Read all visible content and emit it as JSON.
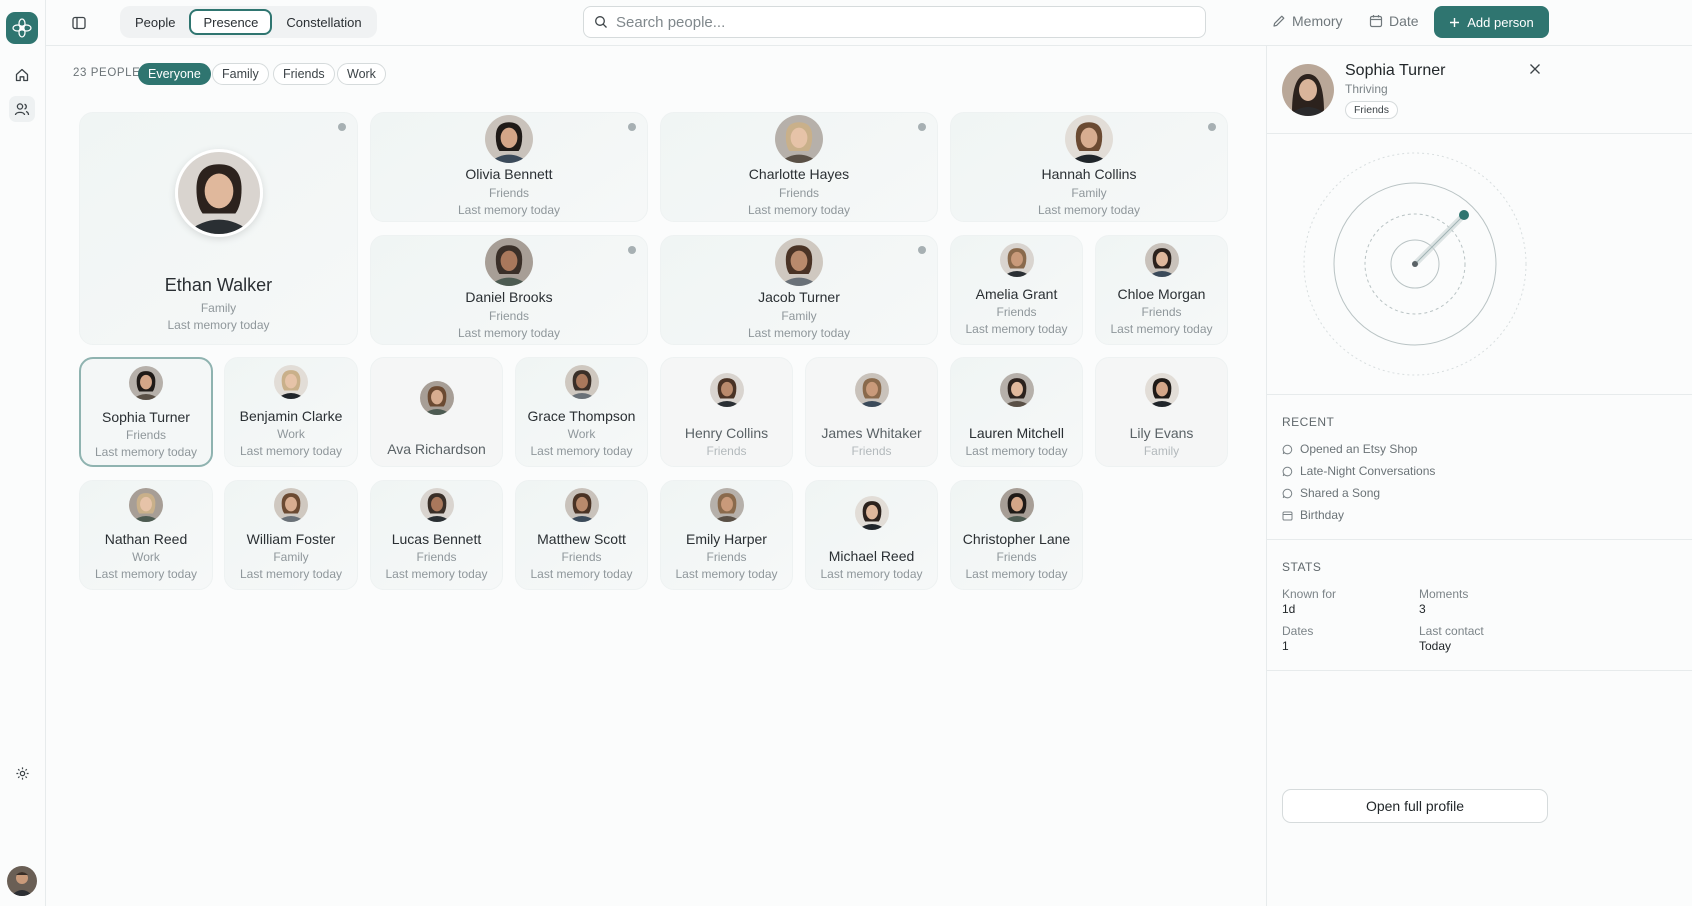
{
  "topbar": {
    "tabs": [
      "People",
      "Presence",
      "Constellation"
    ],
    "active_tab": "Presence",
    "search_placeholder": "Search people...",
    "memory_label": "Memory",
    "date_label": "Date",
    "add_person_label": "Add person"
  },
  "filters": {
    "count_label": "23 PEOPLE",
    "chips": [
      "Everyone",
      "Family",
      "Friends",
      "Work"
    ],
    "active_chip": "Everyone"
  },
  "people": [
    {
      "name": "Ethan Walker",
      "group": "Family",
      "last": "Last memory today"
    },
    {
      "name": "Olivia Bennett",
      "group": "Friends",
      "last": "Last memory today"
    },
    {
      "name": "Charlotte Hayes",
      "group": "Friends",
      "last": "Last memory today"
    },
    {
      "name": "Hannah Collins",
      "group": "Family",
      "last": "Last memory today"
    },
    {
      "name": "Daniel Brooks",
      "group": "Friends",
      "last": "Last memory today"
    },
    {
      "name": "Jacob Turner",
      "group": "Family",
      "last": "Last memory today"
    },
    {
      "name": "Amelia Grant",
      "group": "Friends",
      "last": "Last memory today"
    },
    {
      "name": "Chloe Morgan",
      "group": "Friends",
      "last": "Last memory today"
    },
    {
      "name": "Sophia Turner",
      "group": "Friends",
      "last": "Last memory today"
    },
    {
      "name": "Benjamin Clarke",
      "group": "Work",
      "last": "Last memory today"
    },
    {
      "name": "Ava Richardson",
      "group": "",
      "last": ""
    },
    {
      "name": "Grace Thompson",
      "group": "Work",
      "last": "Last memory today"
    },
    {
      "name": "Henry Collins",
      "group": "Friends",
      "last": ""
    },
    {
      "name": "James Whitaker",
      "group": "Friends",
      "last": ""
    },
    {
      "name": "Lauren Mitchell",
      "group": "",
      "last": "Last memory today"
    },
    {
      "name": "Lily Evans",
      "group": "Family",
      "last": ""
    },
    {
      "name": "Nathan Reed",
      "group": "Work",
      "last": "Last memory today"
    },
    {
      "name": "William Foster",
      "group": "Family",
      "last": "Last memory today"
    },
    {
      "name": "Lucas Bennett",
      "group": "Friends",
      "last": "Last memory today"
    },
    {
      "name": "Matthew Scott",
      "group": "Friends",
      "last": "Last memory today"
    },
    {
      "name": "Emily Harper",
      "group": "Friends",
      "last": "Last memory today"
    },
    {
      "name": "Michael Reed",
      "group": "",
      "last": "Last memory today"
    },
    {
      "name": "Christopher Lane",
      "group": "Friends",
      "last": "Last memory today"
    }
  ],
  "panel": {
    "name": "Sophia Turner",
    "status": "Thriving",
    "group": "Friends",
    "recent_title": "RECENT",
    "recent": [
      {
        "icon": "speech-bubble-icon",
        "label": "Opened an Etsy Shop"
      },
      {
        "icon": "speech-bubble-icon",
        "label": "Late-Night Conversations"
      },
      {
        "icon": "speech-bubble-icon",
        "label": "Shared a Song"
      },
      {
        "icon": "calendar-icon",
        "label": "Birthday"
      }
    ],
    "stats_title": "STATS",
    "stats": [
      {
        "label": "Known for",
        "value": "1d"
      },
      {
        "label": "Moments",
        "value": "3"
      },
      {
        "label": "Dates",
        "value": "1"
      },
      {
        "label": "Last contact",
        "value": "Today"
      }
    ],
    "open_label": "Open full profile"
  },
  "colors": {
    "accent": "#2f7570",
    "border": "#e7ebec"
  }
}
